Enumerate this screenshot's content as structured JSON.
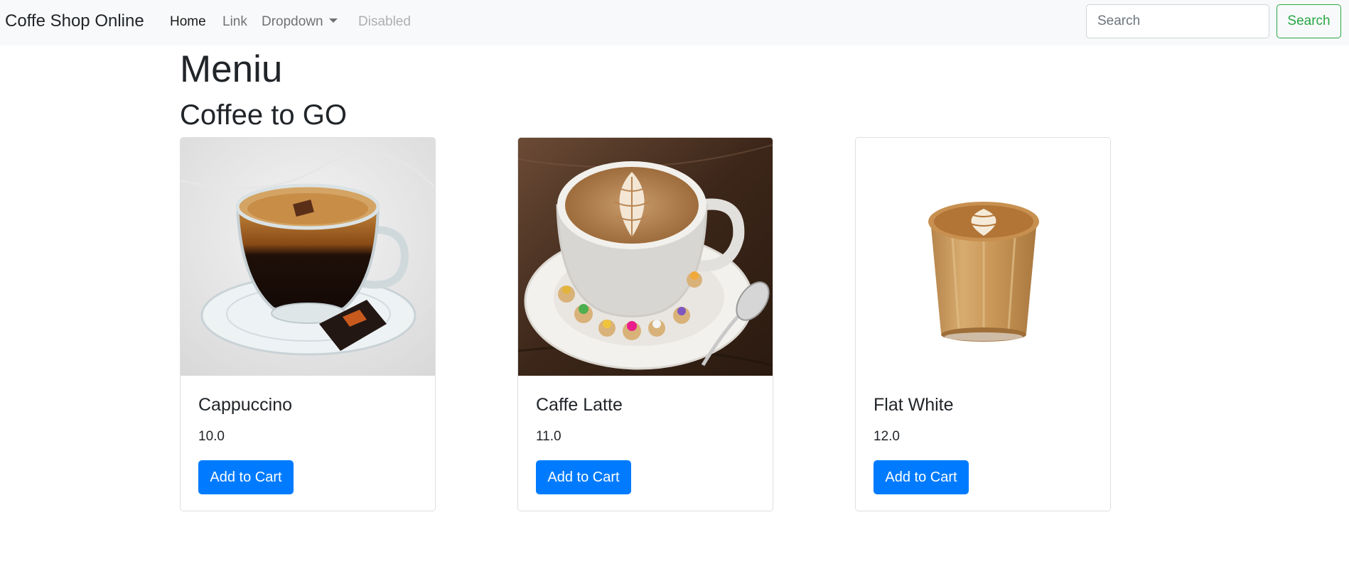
{
  "navbar": {
    "brand": "Coffe Shop Online",
    "links": [
      {
        "label": "Home",
        "state": "active"
      },
      {
        "label": "Link",
        "state": "normal"
      },
      {
        "label": "Dropdown",
        "state": "dropdown"
      },
      {
        "label": "Disabled",
        "state": "disabled"
      }
    ],
    "search_placeholder": "Search",
    "search_value": "",
    "search_button": "Search"
  },
  "page": {
    "title": "Meniu",
    "section": "Coffee to GO"
  },
  "products": [
    {
      "name": "Cappuccino",
      "price": "10.0",
      "button": "Add to Cart",
      "image": "espresso-glass-cup-image"
    },
    {
      "name": "Caffe Latte",
      "price": "11.0",
      "button": "Add to Cart",
      "image": "latte-art-cup-image"
    },
    {
      "name": "Flat White",
      "price": "12.0",
      "button": "Add to Cart",
      "image": "flat-white-glass-image"
    }
  ],
  "colors": {
    "navbar_bg": "#f8f9fa",
    "primary": "#007bff",
    "success": "#28a745",
    "text": "#212529"
  }
}
